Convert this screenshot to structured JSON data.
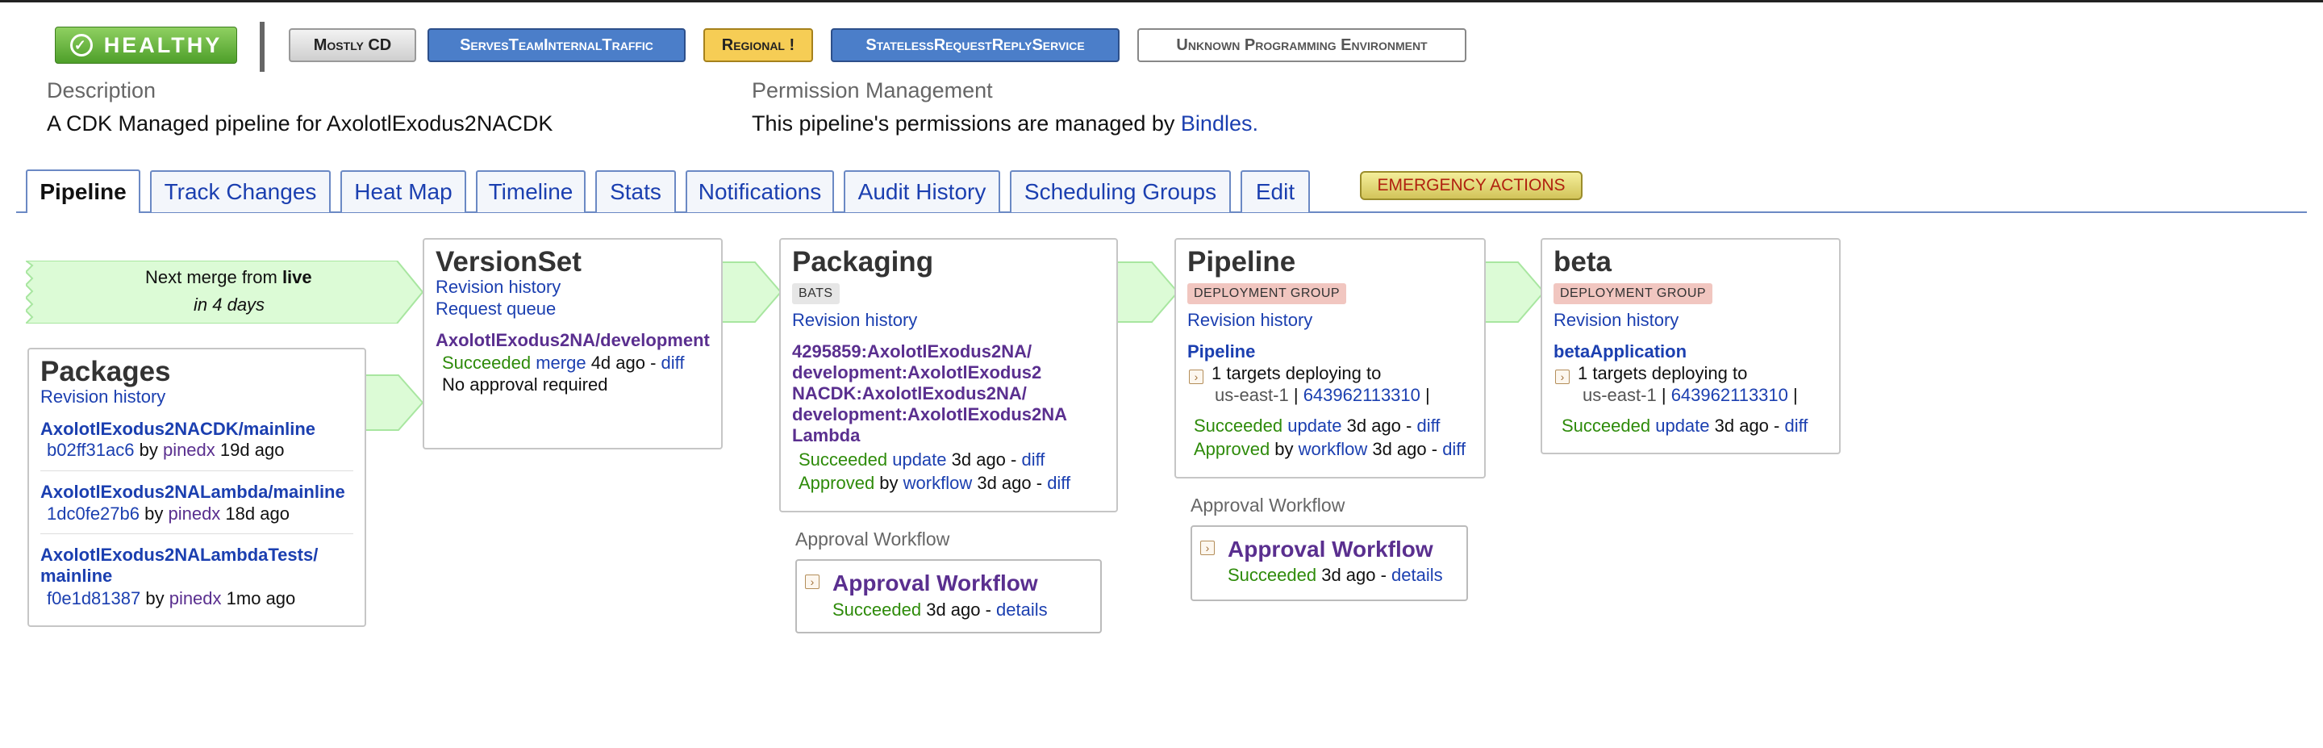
{
  "status": {
    "healthy": "HEALTHY"
  },
  "tags": [
    "Mostly CD",
    "ServesTeamInternalTraffic",
    "Regional !",
    "StatelessRequestReplyService",
    "Unknown Programming Environment"
  ],
  "description": {
    "label": "Description",
    "text": "A CDK Managed pipeline for AxolotlExodus2NACDK"
  },
  "permissions": {
    "label": "Permission Management",
    "text": "This pipeline's permissions are managed by ",
    "link": "Bindles."
  },
  "tabs": [
    "Pipeline",
    "Track Changes",
    "Heat Map",
    "Timeline",
    "Stats",
    "Notifications",
    "Audit History",
    "Scheduling Groups",
    "Edit"
  ],
  "emergency": "EMERGENCY ACTIONS",
  "merge": {
    "prefix": "Next merge from ",
    "source": "live",
    "eta": "in 4 days"
  },
  "packages": {
    "title": "Packages",
    "revision_history": "Revision history",
    "items": [
      {
        "name": "AxolotlExodus2NACDK/mainline",
        "commit": "b02ff31ac6",
        "by": " by ",
        "author": "pinedx",
        "age": " 19d ago"
      },
      {
        "name": "AxolotlExodus2NALambda/mainline",
        "commit": "1dc0fe27b6",
        "by": " by ",
        "author": "pinedx",
        "age": " 18d ago"
      },
      {
        "name_line1": "AxolotlExodus2NALambdaTests/",
        "name_line2": "mainline",
        "commit": "f0e1d81387",
        "by": " by ",
        "author": "pinedx",
        "age": " 1mo ago"
      }
    ]
  },
  "versionset": {
    "title": "VersionSet",
    "revision_history": "Revision history",
    "request_queue": "Request queue",
    "name": "AxolotlExodus2NA/development",
    "succeeded": "Succeeded",
    "action": "merge",
    "age": " 4d ago - ",
    "diff": "diff",
    "approval": "No approval required"
  },
  "packaging": {
    "title": "Packaging",
    "pill": "BATS",
    "revision_history": "Revision history",
    "name_lines": [
      "4295859:AxolotlExodus2NA/",
      "development:AxolotlExodus2",
      "NACDK:AxolotlExodus2NA/",
      "development:AxolotlExodus2NA",
      "Lambda"
    ],
    "succeeded": "Succeeded",
    "action": "update",
    "age1": " 3d ago - ",
    "diff": "diff",
    "approved": "Approved",
    "by": " by ",
    "workflow": "workflow",
    "age2": " 3d ago - "
  },
  "packaging_workflow": {
    "heading": "Approval Workflow",
    "title": "Approval Workflow",
    "succeeded": "Succeeded",
    "age": " 3d ago - ",
    "details": "details"
  },
  "pipeline": {
    "title": "Pipeline",
    "pill": "DEPLOYMENT GROUP",
    "revision_history": "Revision history",
    "target_name": "Pipeline",
    "targets": "1 targets deploying to",
    "region": "us-east-1",
    "account": "643962113310",
    "succeeded": "Succeeded",
    "action": "update",
    "age1": " 3d ago - ",
    "diff": "diff",
    "approved": "Approved",
    "by": " by ",
    "workflow": "workflow",
    "age2": " 3d ago - "
  },
  "pipeline_workflow": {
    "heading": "Approval Workflow",
    "title": "Approval Workflow",
    "succeeded": "Succeeded",
    "age": " 3d ago - ",
    "details": "details"
  },
  "beta": {
    "title": "beta",
    "pill": "DEPLOYMENT GROUP",
    "revision_history": "Revision history",
    "target_name": "betaApplication",
    "targets": "1 targets deploying to",
    "region": "us-east-1",
    "account": "643962113310",
    "succeeded": "Succeeded",
    "action": "update",
    "age": " 3d ago - ",
    "diff": "diff"
  },
  "colors": {
    "link": "#1b3fb0",
    "success": "#2e8b0a",
    "purple": "#5a2f8f",
    "healthy": "#5aa834"
  },
  "icons": {
    "healthy": "check-circle-icon",
    "expand": "chevron-right-icon"
  }
}
